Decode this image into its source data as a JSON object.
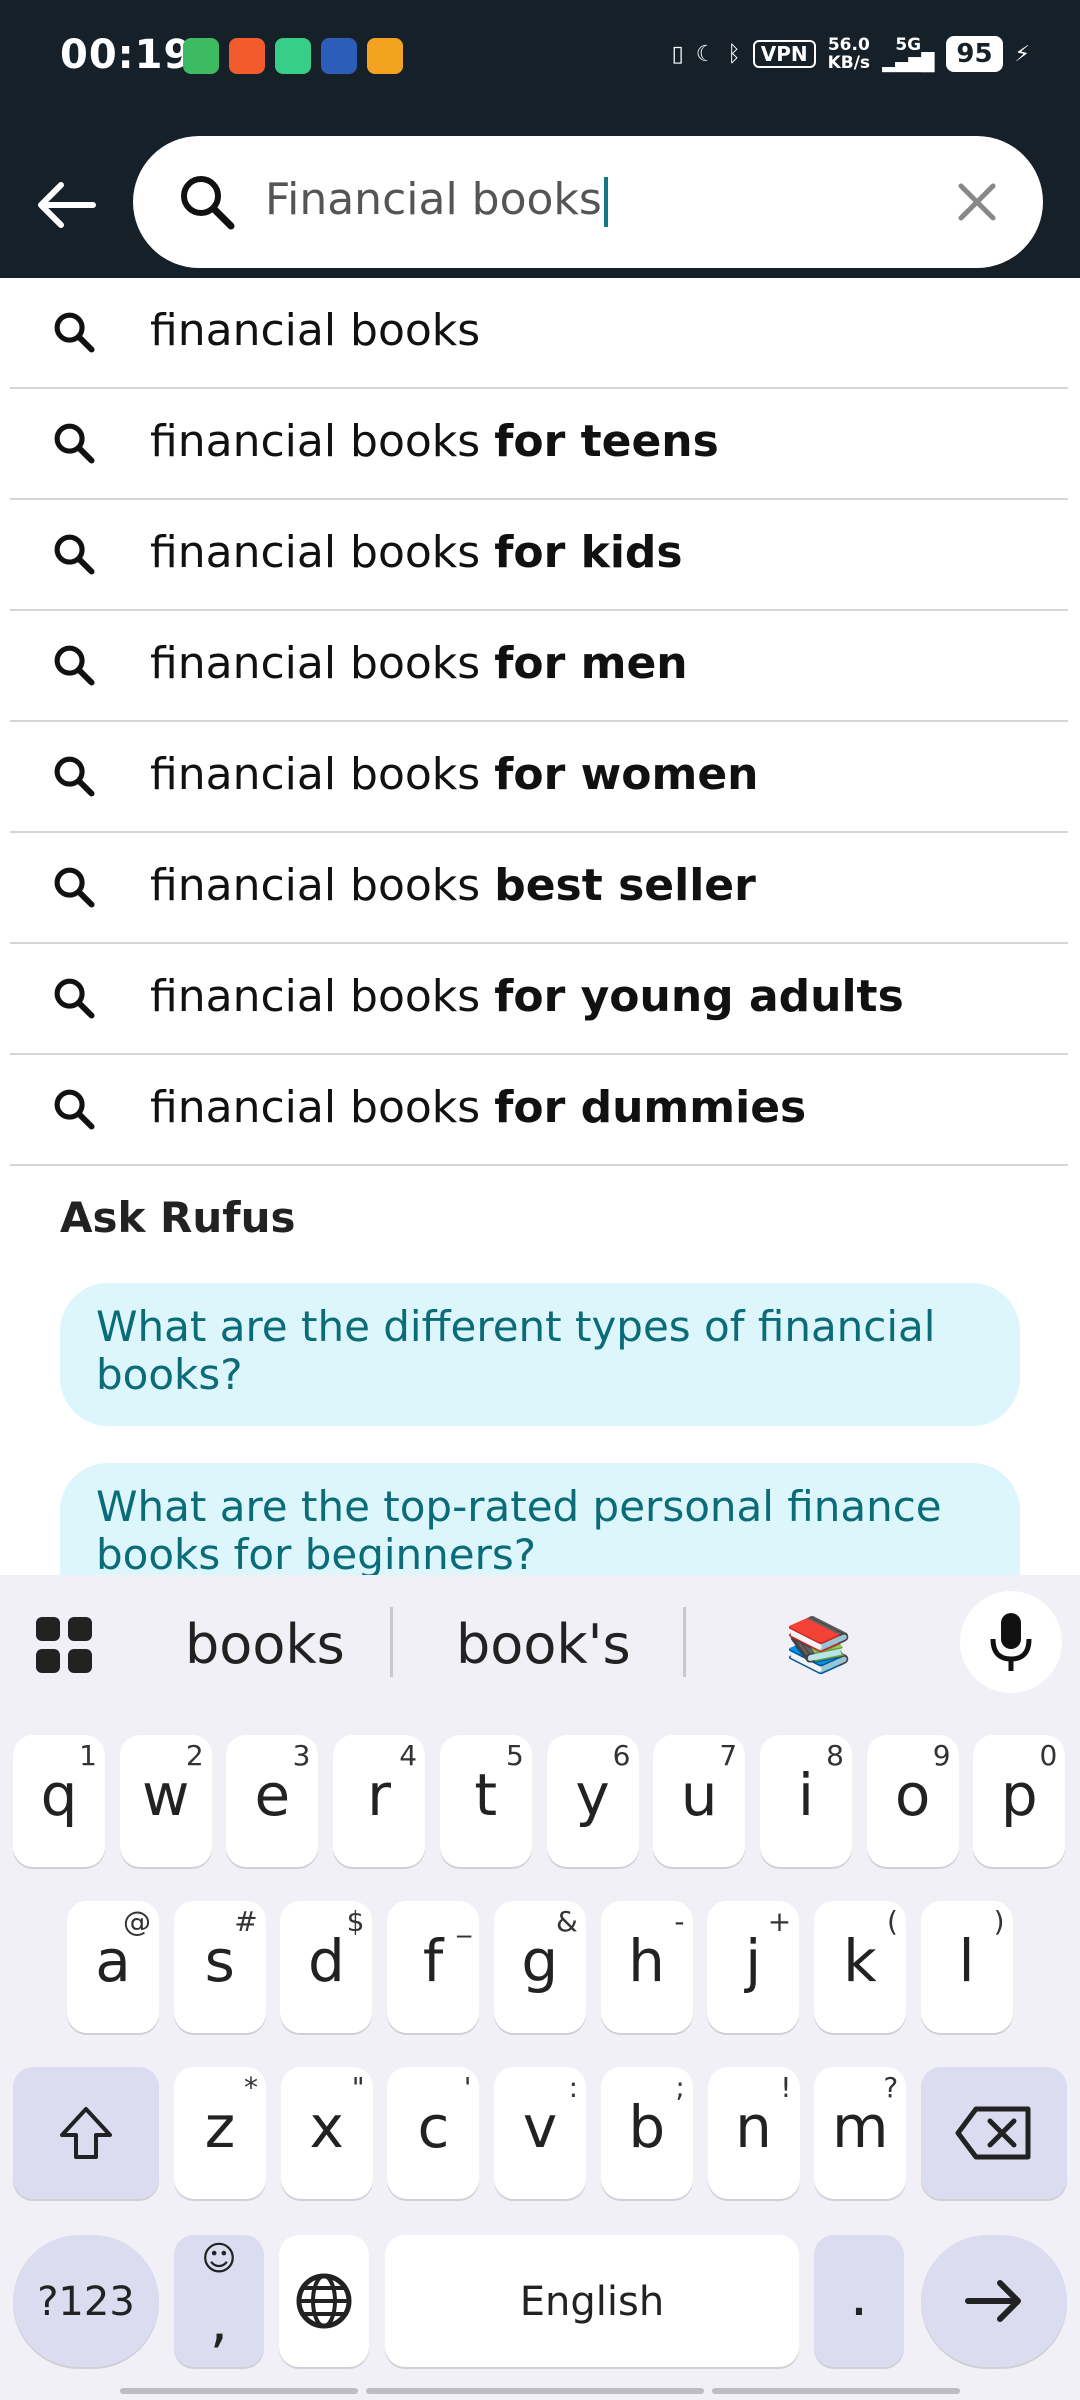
{
  "status_bar": {
    "time": "00:19",
    "vpn": "VPN",
    "net_speed_top": "56.0",
    "net_speed_bottom": "KB/s",
    "network": "5G",
    "battery": "95"
  },
  "search": {
    "query": "Financial books",
    "back_icon": "back-arrow-icon",
    "clear_icon": "close-icon"
  },
  "suggestions": [
    {
      "base": "financial books",
      "bold": ""
    },
    {
      "base": "financial books ",
      "bold": "for teens"
    },
    {
      "base": "financial books ",
      "bold": "for kids"
    },
    {
      "base": "financial books ",
      "bold": "for men"
    },
    {
      "base": "financial books ",
      "bold": "for women"
    },
    {
      "base": "financial books ",
      "bold": "best seller"
    },
    {
      "base": "financial books ",
      "bold": "for young adults"
    },
    {
      "base": "financial books ",
      "bold": "for dummies"
    }
  ],
  "rufus": {
    "title": "Ask Rufus",
    "questions": [
      "What are the different types of financial books?",
      "What are the top-rated personal finance books for beginners?"
    ]
  },
  "keyboard": {
    "suggestions": [
      "books",
      "book's"
    ],
    "emoji_suggestion": "📚",
    "row1": [
      [
        "q",
        "1"
      ],
      [
        "w",
        "2"
      ],
      [
        "e",
        "3"
      ],
      [
        "r",
        "4"
      ],
      [
        "t",
        "5"
      ],
      [
        "y",
        "6"
      ],
      [
        "u",
        "7"
      ],
      [
        "i",
        "8"
      ],
      [
        "o",
        "9"
      ],
      [
        "p",
        "0"
      ]
    ],
    "row2": [
      [
        "a",
        "@"
      ],
      [
        "s",
        "#"
      ],
      [
        "d",
        "$"
      ],
      [
        "f",
        "_"
      ],
      [
        "g",
        "&"
      ],
      [
        "h",
        "-"
      ],
      [
        "j",
        "+"
      ],
      [
        "k",
        "("
      ],
      [
        "l",
        ")"
      ]
    ],
    "row3": [
      [
        "z",
        "*"
      ],
      [
        "x",
        "\""
      ],
      [
        "c",
        "'"
      ],
      [
        "v",
        ":"
      ],
      [
        "b",
        ";"
      ],
      [
        "n",
        "!"
      ],
      [
        "m",
        "?"
      ]
    ],
    "symbols_label": "?123",
    "comma_label": ",",
    "emoji_label": "☺",
    "space_label": "English",
    "period_label": ".",
    "enter_icon": "arrow-right-icon"
  },
  "colors": {
    "header_bg": "#162029",
    "chip_bg": "#dcf6fb",
    "chip_text": "#0a6c78",
    "keyboard_bg": "#f1f0f7"
  }
}
